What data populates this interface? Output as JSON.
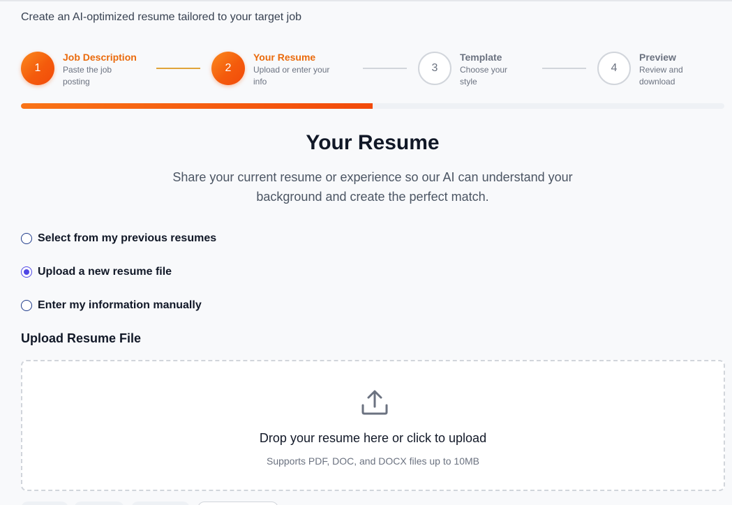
{
  "header": {
    "subtitle": "Create an AI-optimized resume tailored to your target job"
  },
  "stepper": {
    "steps": [
      {
        "number": "1",
        "title": "Job Description",
        "desc_line1": "Paste the job",
        "desc_line2": "posting",
        "state": "completed"
      },
      {
        "number": "2",
        "title": "Your Resume",
        "desc_line1": "Upload or enter your",
        "desc_line2": "info",
        "state": "current"
      },
      {
        "number": "3",
        "title": "Template",
        "desc_line1": "Choose your",
        "desc_line2": "style",
        "state": "upcoming"
      },
      {
        "number": "4",
        "title": "Preview",
        "desc_line1": "Review and",
        "desc_line2": "download",
        "state": "upcoming"
      }
    ],
    "progress_percent": 50,
    "colors": {
      "accent": "#f45b0c",
      "accent_text": "#ea6a0c",
      "connector_done": "#e0a43a"
    }
  },
  "main": {
    "title": "Your Resume",
    "description": "Share your current resume or experience so our AI can understand your background and create the perfect match."
  },
  "options": {
    "items": [
      {
        "label": "Select from my previous resumes",
        "checked": false
      },
      {
        "label": "Upload a new resume file",
        "checked": true
      },
      {
        "label": "Enter my information manually",
        "checked": false
      }
    ],
    "selected_color": "#4f46e5"
  },
  "upload": {
    "heading": "Upload Resume File",
    "icon": "upload-icon",
    "primary_text": "Drop your resume here or click to upload",
    "secondary_text": "Supports PDF, DOC, and DOCX files up to 10MB"
  }
}
